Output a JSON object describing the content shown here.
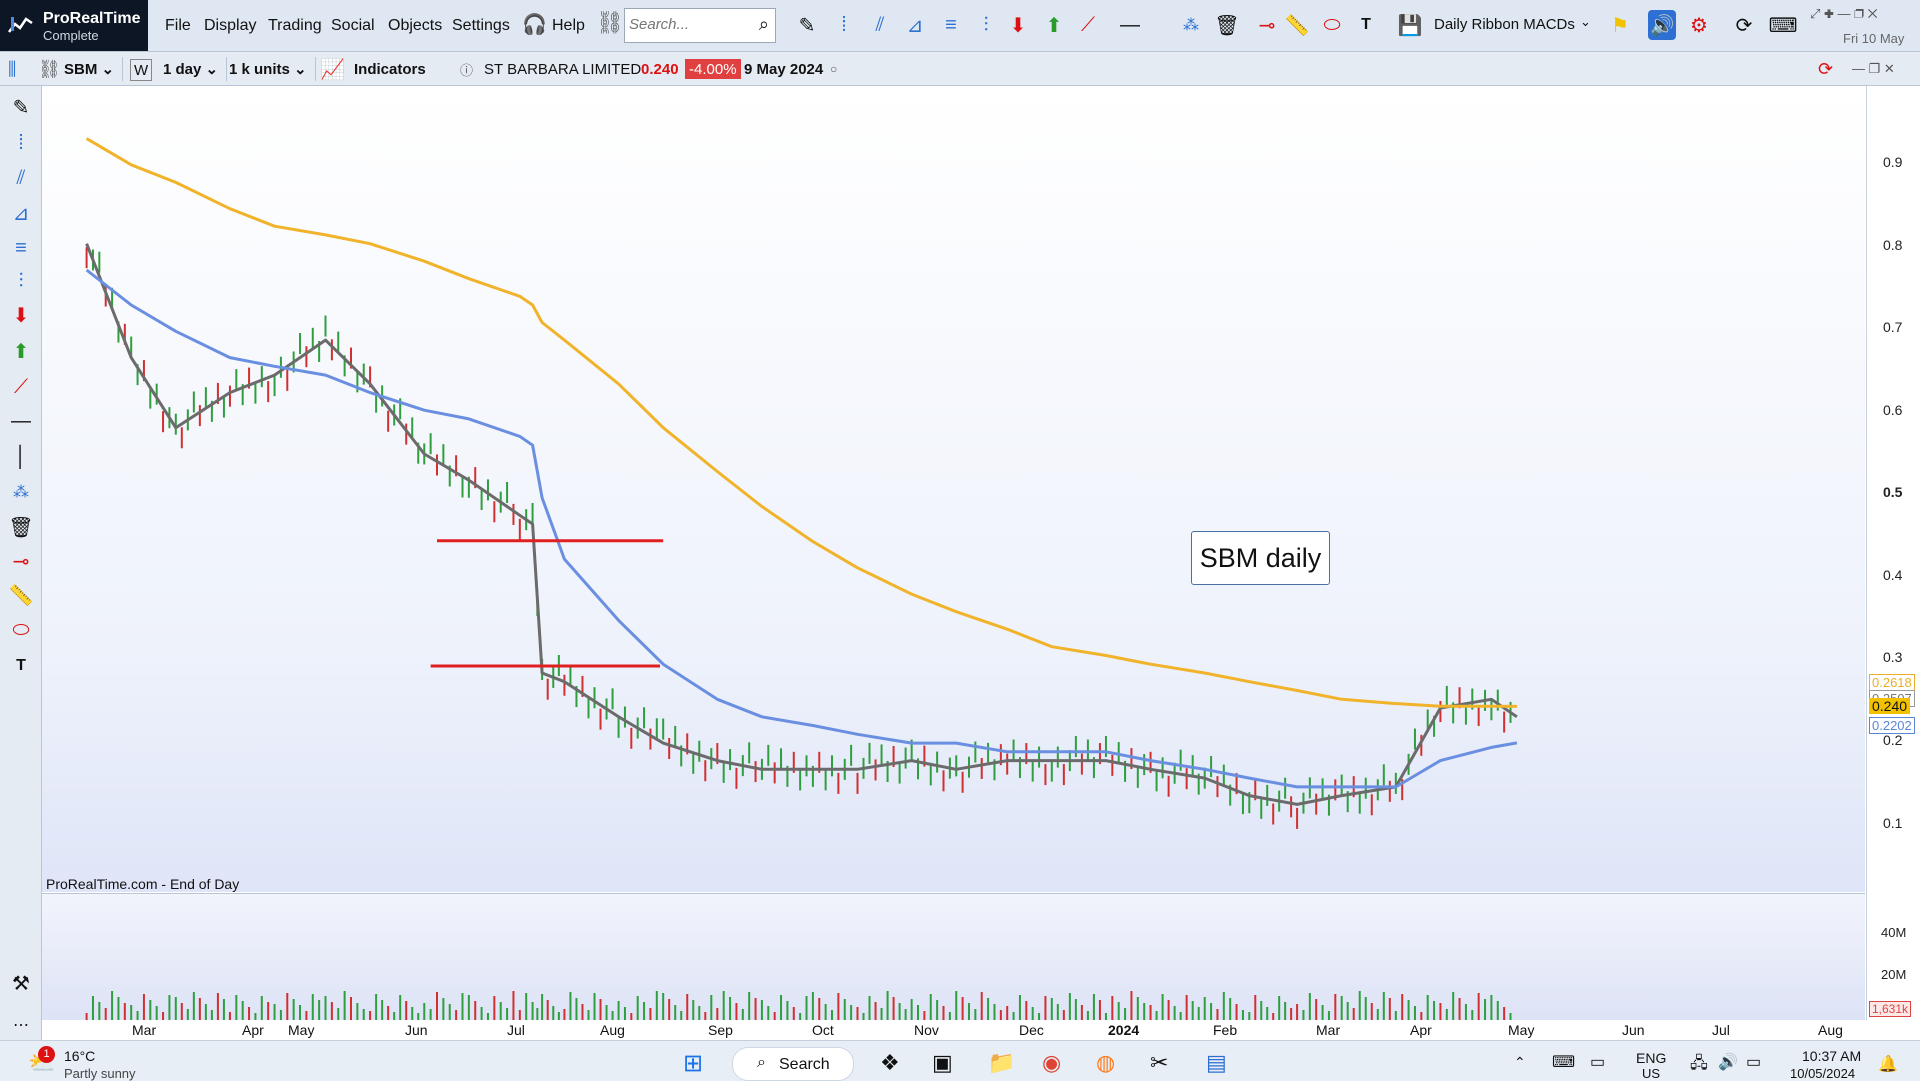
{
  "app": {
    "name": "ProRealTime",
    "edition": "Complete"
  },
  "menu": [
    "File",
    "Display",
    "Trading",
    "Social",
    "Objects",
    "Settings",
    "Help"
  ],
  "search": {
    "placeholder": "Search..."
  },
  "workspace": {
    "name": "Daily Ribbon MACDs"
  },
  "clock_top": "Fri 10 May",
  "toolbar": {
    "ticker": "SBM",
    "w_label": "W",
    "interval": "1 day",
    "units": "1 k units",
    "indicators_label": "Indicators",
    "instrument_name": "ST BARBARA LIMITED",
    "last_price": "0.240",
    "change_pct": "-4.00%",
    "date": "9 May 2024"
  },
  "chart": {
    "annotation": "SBM daily",
    "source": "ProRealTime.com - End of Day",
    "y_ticks": [
      "0.9",
      "0.8",
      "0.7",
      "0.6",
      "0.5",
      "0.4",
      "0.3",
      "0.2",
      "0.1"
    ],
    "price_tags": [
      {
        "text": "0.2618",
        "color": "#e8b02a"
      },
      {
        "text": "0.2507",
        "color": "#777777"
      },
      {
        "text": "0.240",
        "color": "#f2c200"
      },
      {
        "text": "0.2202",
        "color": "#5b86d6"
      }
    ],
    "volume_ticks": [
      "40M",
      "20M"
    ],
    "volume_tag": "1,631k",
    "x_ticks": [
      "Mar",
      "Apr",
      "May",
      "Jun",
      "Jul",
      "Aug",
      "Sep",
      "Oct",
      "Nov",
      "Dec",
      "2024",
      "Feb",
      "Mar",
      "Apr",
      "May",
      "Jun",
      "Jul",
      "Aug"
    ],
    "colors": {
      "ma_long": "#f0b32a",
      "ma_mid": "#6a8fe0",
      "ma_short": "#6b6b6b",
      "hline": "#e02020",
      "up": "#2e9e3e",
      "down": "#d03030"
    }
  },
  "chart_data": {
    "type": "line",
    "title": "ST BARBARA LIMITED",
    "xlabel": "",
    "ylabel": "",
    "ylim": [
      0.05,
      0.97
    ],
    "x": [
      "2023-02-15",
      "2023-03-01",
      "2023-03-15",
      "2023-04-01",
      "2023-04-15",
      "2023-05-01",
      "2023-05-15",
      "2023-06-01",
      "2023-06-15",
      "2023-07-01",
      "2023-07-05",
      "2023-07-08",
      "2023-07-15",
      "2023-08-01",
      "2023-08-15",
      "2023-09-01",
      "2023-09-15",
      "2023-10-01",
      "2023-10-15",
      "2023-11-01",
      "2023-11-15",
      "2023-12-01",
      "2023-12-15",
      "2024-01-01",
      "2024-01-15",
      "2024-02-01",
      "2024-02-15",
      "2024-03-01",
      "2024-03-15",
      "2024-04-01",
      "2024-04-15",
      "2024-05-01",
      "2024-05-09"
    ],
    "series": [
      {
        "values": [
          0.79,
          0.66,
          0.58,
          0.62,
          0.64,
          0.68,
          0.63,
          0.55,
          0.52,
          0.48,
          0.47,
          0.3,
          0.29,
          0.25,
          0.22,
          0.2,
          0.19,
          0.19,
          0.19,
          0.2,
          0.19,
          0.2,
          0.2,
          0.2,
          0.19,
          0.18,
          0.16,
          0.15,
          0.16,
          0.17,
          0.26,
          0.27,
          0.25
        ]
      },
      {
        "values": [
          0.76,
          0.72,
          0.69,
          0.66,
          0.65,
          0.64,
          0.62,
          0.6,
          0.59,
          0.57,
          0.56,
          0.5,
          0.43,
          0.36,
          0.31,
          0.27,
          0.25,
          0.24,
          0.23,
          0.22,
          0.22,
          0.21,
          0.21,
          0.21,
          0.2,
          0.19,
          0.18,
          0.17,
          0.17,
          0.17,
          0.2,
          0.215,
          0.2202
        ]
      },
      {
        "values": [
          0.91,
          0.88,
          0.86,
          0.83,
          0.81,
          0.8,
          0.79,
          0.77,
          0.75,
          0.73,
          0.72,
          0.7,
          0.68,
          0.63,
          0.58,
          0.53,
          0.49,
          0.45,
          0.42,
          0.39,
          0.37,
          0.35,
          0.33,
          0.32,
          0.31,
          0.3,
          0.29,
          0.28,
          0.27,
          0.265,
          0.262,
          0.262,
          0.2618
        ]
      }
    ]
  },
  "hlines": [
    {
      "y": 0.451,
      "x_start": "2023-06-05",
      "x_end": "2023-08-15"
    },
    {
      "y": 0.308,
      "x_start": "2023-06-03",
      "x_end": "2023-08-14"
    }
  ],
  "taskbar": {
    "weather_badge": "1",
    "temperature": "16°C",
    "weather": "Partly sunny",
    "search_label": "Search",
    "lang_top": "ENG",
    "lang_bottom": "US",
    "time": "10:37 AM",
    "date": "10/05/2024"
  }
}
